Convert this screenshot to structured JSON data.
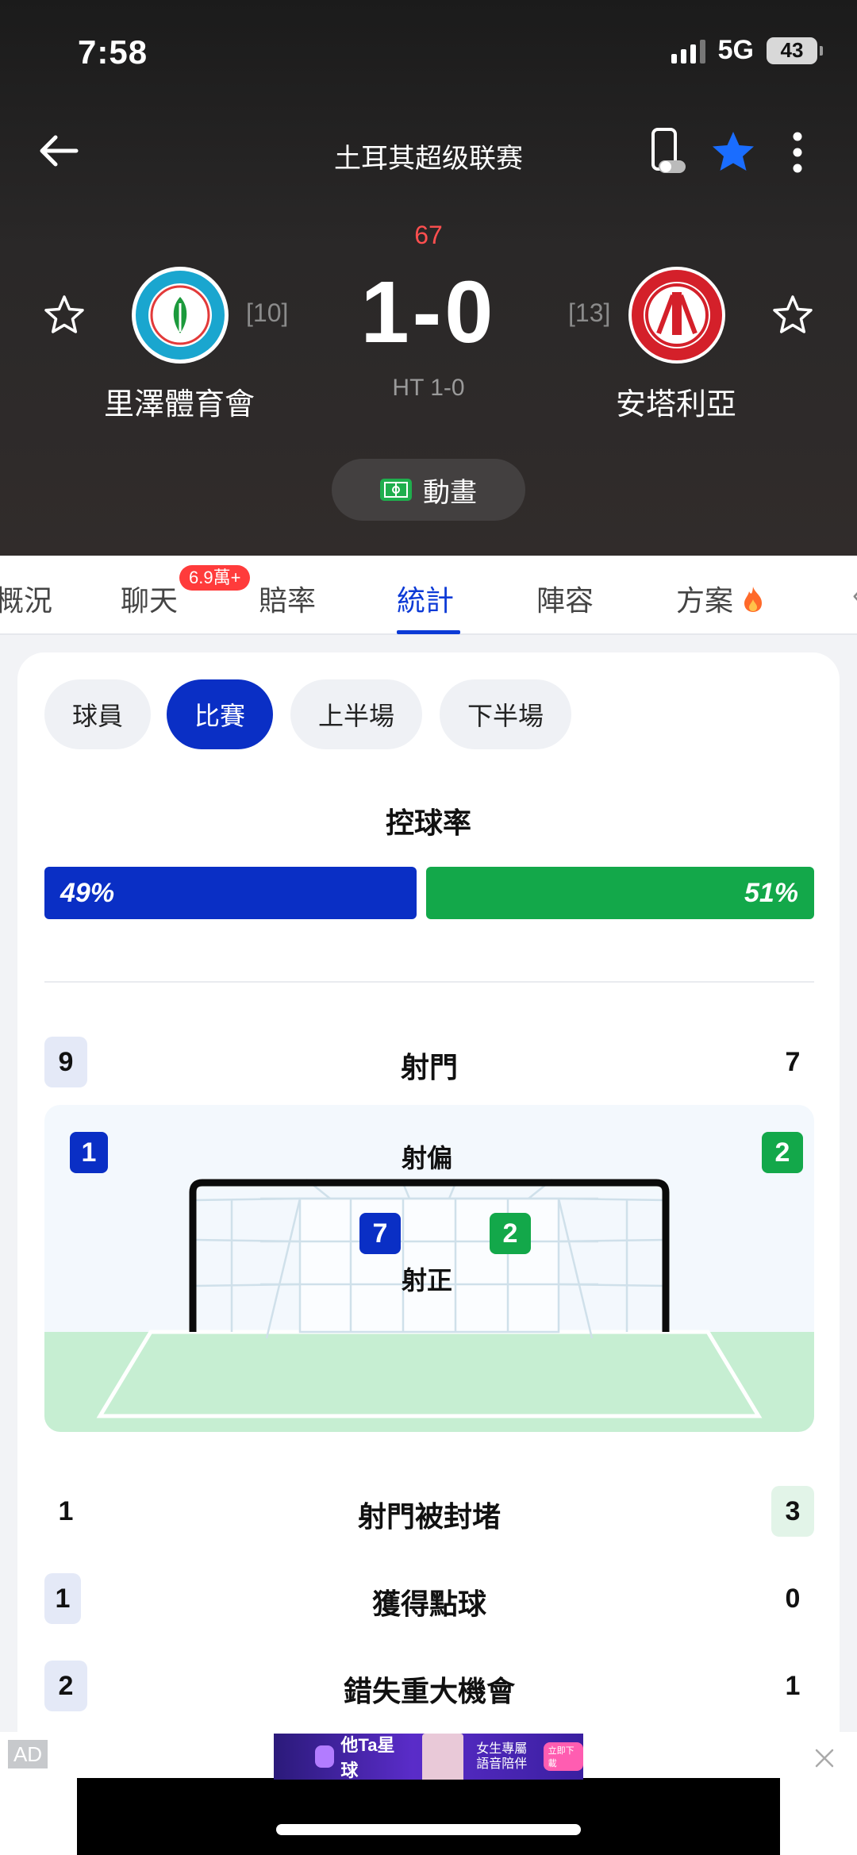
{
  "status": {
    "time": "7:58",
    "network": "5G",
    "battery": "43"
  },
  "header": {
    "league": "土耳其超级联赛",
    "minute": "67",
    "score": "1-0",
    "halftime": "HT 1-0",
    "animation_label": "動畫"
  },
  "home": {
    "name": "里澤體育會",
    "rank": "[10]"
  },
  "away": {
    "name": "安塔利亞",
    "rank": "[13]"
  },
  "tabs": [
    {
      "label": "概況"
    },
    {
      "label": "聊天"
    },
    {
      "label": "賠率"
    },
    {
      "label": "統計"
    },
    {
      "label": "陣容"
    },
    {
      "label": "方案"
    }
  ],
  "chat_badge": "6.9萬+",
  "segments": [
    {
      "label": "球員"
    },
    {
      "label": "比賽"
    },
    {
      "label": "上半場"
    },
    {
      "label": "下半場"
    }
  ],
  "possession": {
    "title": "控球率",
    "home": "49%",
    "away": "51%",
    "home_fraction": 0.49
  },
  "shots": {
    "label": "射門",
    "home": "9",
    "away": "7"
  },
  "off_target": {
    "label": "射偏",
    "home": "1",
    "away": "2"
  },
  "on_target": {
    "label": "射正",
    "home": "7",
    "away": "2"
  },
  "stats": [
    {
      "label": "射門被封堵",
      "home": "1",
      "away": "3"
    },
    {
      "label": "獲得點球",
      "home": "1",
      "away": "0"
    },
    {
      "label": "錯失重大機會",
      "home": "2",
      "away": "1"
    }
  ],
  "ad": {
    "label": "AD",
    "banner_title": "他Ta星球",
    "banner_text": "女生專屬語音陪伴",
    "banner_button": "立即下載"
  },
  "colors": {
    "accent": "#0c3ad6",
    "home": "#0a2fc5",
    "away": "#13a84a",
    "minute": "#ff4f4f"
  }
}
